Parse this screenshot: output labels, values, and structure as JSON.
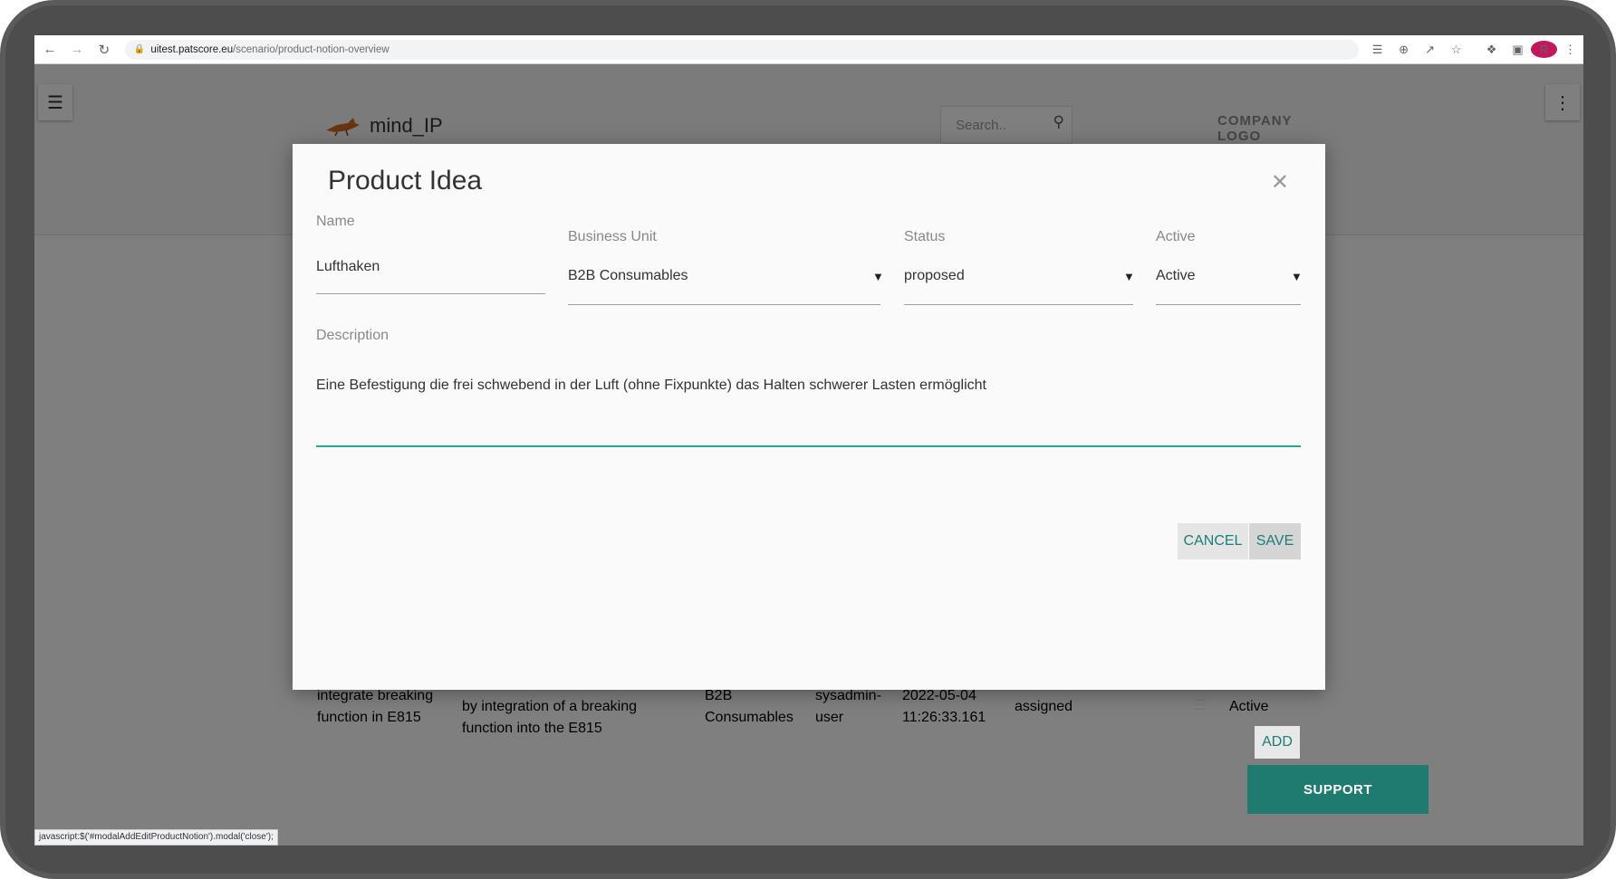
{
  "browser": {
    "url_host": "uitest.patscore.eu",
    "url_path": "/scenario/product-notion-overview",
    "profile_initial": "R",
    "status_bar_text": "javascript:$('#modalAddEditProductNotion').modal('close');"
  },
  "header": {
    "app_name": "mind_IP",
    "search_placeholder": "Search..",
    "company_logo_line1": "COMPANY",
    "company_logo_line2": "LOGO"
  },
  "background_row": {
    "name": "integrate breaking\nfunction in E815",
    "description": "by integration of a breaking\nfunction into the E815",
    "business_unit": "B2B\nConsumables",
    "user": "sysadmin-\nuser",
    "date": "2022-05-04\n11:26:33.161",
    "status": "assigned",
    "active": "Active"
  },
  "buttons": {
    "add": "ADD",
    "support": "SUPPORT"
  },
  "modal": {
    "title": "Product Idea",
    "name_label": "Name",
    "name_value": "Lufthaken",
    "business_unit_label": "Business Unit",
    "business_unit_value": "B2B Consumables",
    "status_label": "Status",
    "status_value": "proposed",
    "active_label": "Active",
    "active_value": "Active",
    "description_label": "Description",
    "description_value": "Eine Befestigung die frei schwebend in der Luft (ohne Fixpunkte) das Halten schwerer Lasten ermöglicht",
    "cancel_label": "CANCEL",
    "save_label": "SAVE"
  },
  "colors": {
    "accent": "#26a69a",
    "button_text": "#1a7f76",
    "support_bg": "#1f7a70"
  }
}
